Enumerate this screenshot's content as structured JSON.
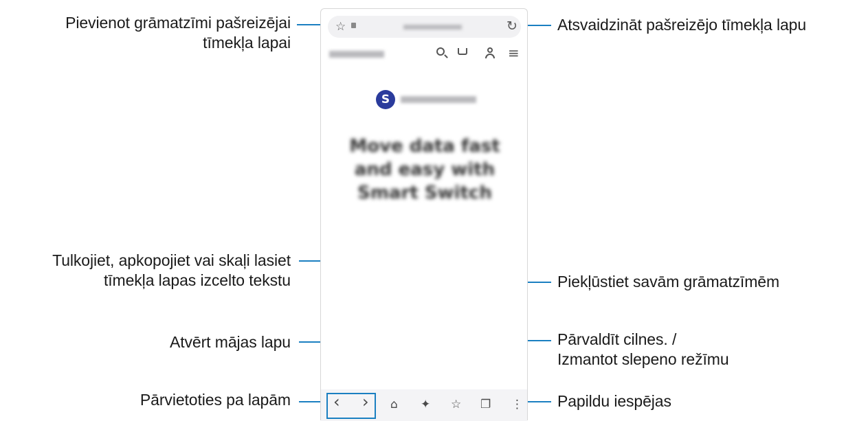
{
  "callouts": {
    "bookmark_add": [
      "Pievienot grāmatzīmi pašreizējai",
      "tīmekļa lapai"
    ],
    "refresh": [
      "Atsvaidzināt pašreizējo tīmekļa lapu"
    ],
    "translate": [
      "Tulkojiet, apkopojiet vai skaļi lasiet",
      "tīmekļa lapas izcelto tekstu"
    ],
    "bookmarks": [
      "Piekļūstiet savām grāmatzīmēm"
    ],
    "home": [
      "Atvērt mājas lapu"
    ],
    "tabs": [
      "Pārvaldīt cilnes. /",
      "Izmantot slepeno režīmu"
    ],
    "navigate": [
      "Pārvietoties pa lapām"
    ],
    "more": [
      "Papildu iespējas"
    ]
  },
  "browser": {
    "brand_initial": "S",
    "hero_text": "Move data fast and easy with Smart Switch",
    "icons": {
      "star": "☆",
      "lock": "🔒",
      "refresh": "↻",
      "search": "⌕",
      "cart": "🛒",
      "user": "👤",
      "menu": "≡",
      "back": "‹",
      "forward": "›",
      "home": "⌂",
      "sparkle": "✦",
      "bookmarks": "☆",
      "tabs": "❐",
      "more": "⋮"
    }
  },
  "colors": {
    "accent": "#1a7fc1",
    "brand": "#2a3b9c"
  }
}
